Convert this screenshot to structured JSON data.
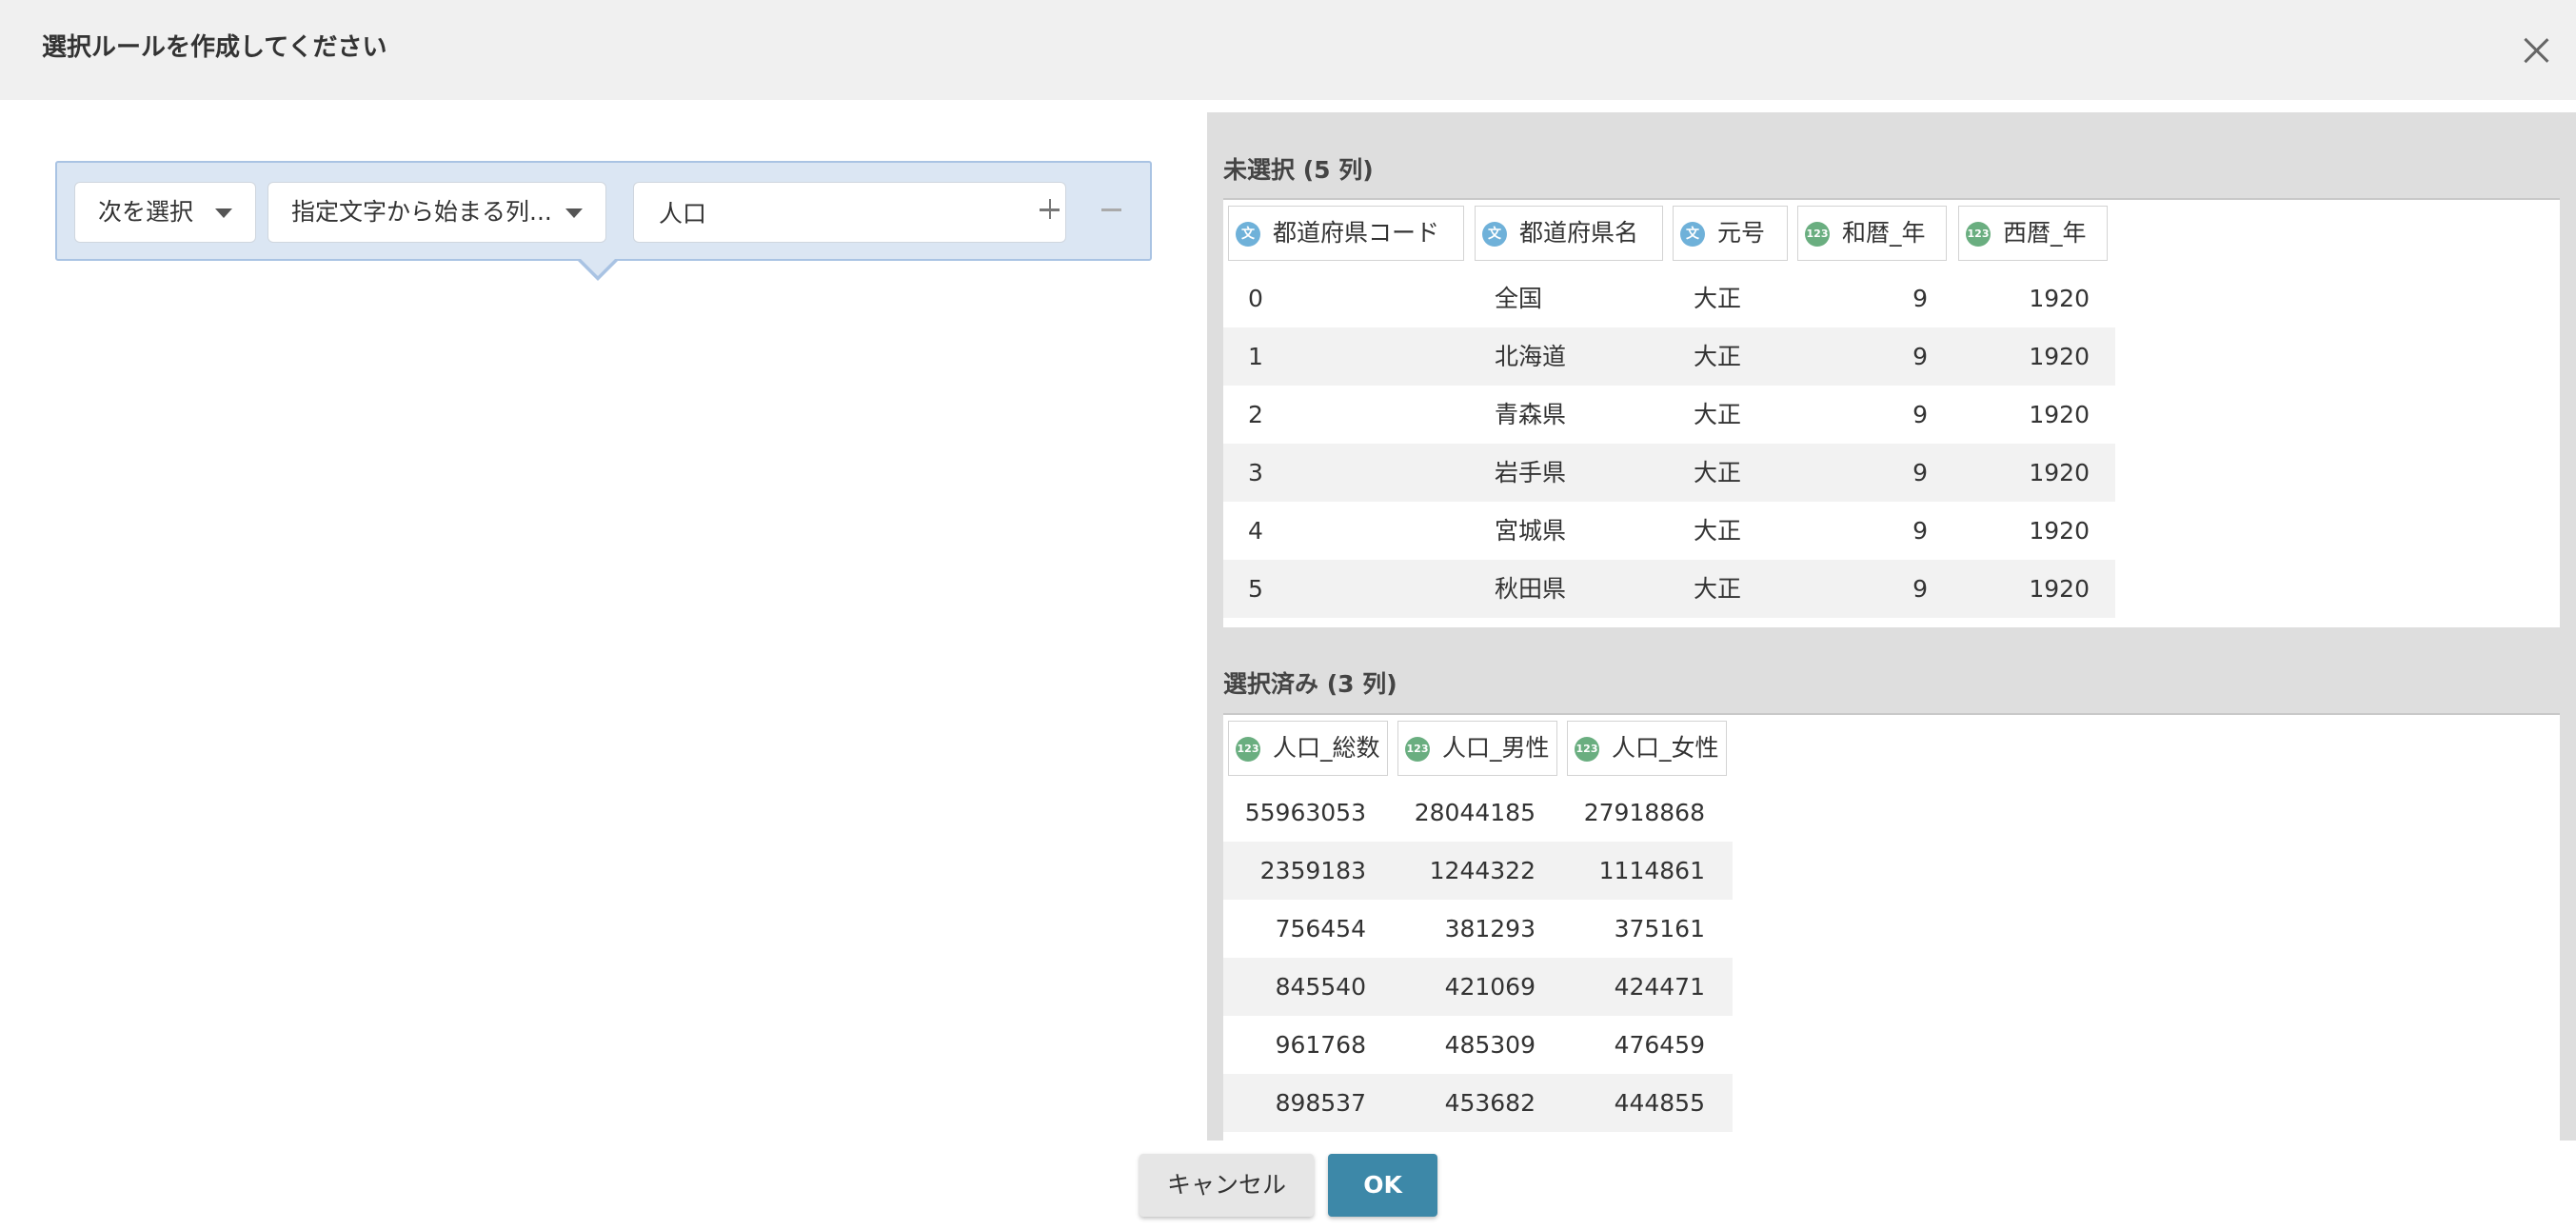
{
  "dialog": {
    "title": "選択ルールを作成してください"
  },
  "rule": {
    "mode_select": "次を選択",
    "condition_select": "指定文字から始まる列...",
    "value": "人口"
  },
  "unselected": {
    "title": "未選択 (5 列)",
    "columns": [
      {
        "name": "都道府県コード",
        "type_badge": "文"
      },
      {
        "name": "都道府県名",
        "type_badge": "文"
      },
      {
        "name": "元号",
        "type_badge": "文"
      },
      {
        "name": "和暦_年",
        "type_badge": "123"
      },
      {
        "name": "西暦_年",
        "type_badge": "123"
      }
    ],
    "rows": [
      [
        "0",
        "全国",
        "大正",
        "9",
        "1920"
      ],
      [
        "1",
        "北海道",
        "大正",
        "9",
        "1920"
      ],
      [
        "2",
        "青森県",
        "大正",
        "9",
        "1920"
      ],
      [
        "3",
        "岩手県",
        "大正",
        "9",
        "1920"
      ],
      [
        "4",
        "宮城県",
        "大正",
        "9",
        "1920"
      ],
      [
        "5",
        "秋田県",
        "大正",
        "9",
        "1920"
      ]
    ]
  },
  "selected": {
    "title": "選択済み (3 列)",
    "columns": [
      {
        "name": "人口_総数",
        "type_badge": "123"
      },
      {
        "name": "人口_男性",
        "type_badge": "123"
      },
      {
        "name": "人口_女性",
        "type_badge": "123"
      }
    ],
    "rows": [
      [
        "55963053",
        "28044185",
        "27918868"
      ],
      [
        "2359183",
        "1244322",
        "1114861"
      ],
      [
        "756454",
        "381293",
        "375161"
      ],
      [
        "845540",
        "421069",
        "424471"
      ],
      [
        "961768",
        "485309",
        "476459"
      ],
      [
        "898537",
        "453682",
        "444855"
      ]
    ]
  },
  "footer": {
    "cancel_label": "キャンセル",
    "ok_label": "OK"
  },
  "colors": {
    "ok_button": "#3d88a8",
    "string_badge": "#6fb1d9",
    "number_badge": "#6aae80",
    "rule_background": "#dbe6f3"
  }
}
